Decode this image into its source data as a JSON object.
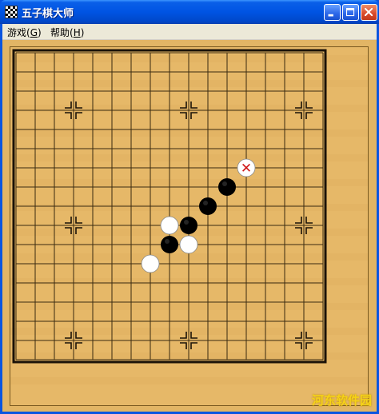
{
  "window": {
    "title": "五子棋大师",
    "controls": [
      "minimize",
      "maximize",
      "close"
    ]
  },
  "menu": {
    "items": [
      {
        "label": "游戏",
        "accel": "G"
      },
      {
        "label": "帮助",
        "accel": "H"
      }
    ]
  },
  "board": {
    "size": 15,
    "star_points": [
      [
        3,
        3
      ],
      [
        3,
        9
      ],
      [
        3,
        15
      ],
      [
        9,
        3
      ],
      [
        9,
        15
      ],
      [
        15,
        3
      ],
      [
        15,
        9
      ],
      [
        15,
        15
      ]
    ],
    "stones": [
      {
        "color": "black",
        "col": 11,
        "row": 7
      },
      {
        "color": "black",
        "col": 10,
        "row": 8
      },
      {
        "color": "black",
        "col": 9,
        "row": 9
      },
      {
        "color": "black",
        "col": 8,
        "row": 10
      },
      {
        "color": "white",
        "col": 8,
        "row": 9
      },
      {
        "color": "white",
        "col": 9,
        "row": 10
      },
      {
        "color": "white",
        "col": 7,
        "row": 11
      }
    ],
    "last_move": {
      "color": "white",
      "col": 12,
      "row": 6,
      "marker": "✕"
    }
  },
  "watermark": "河东软件园",
  "colors": {
    "board": "#e6b868",
    "grid": "#3a2a10",
    "title_blue": "#0054e3"
  }
}
